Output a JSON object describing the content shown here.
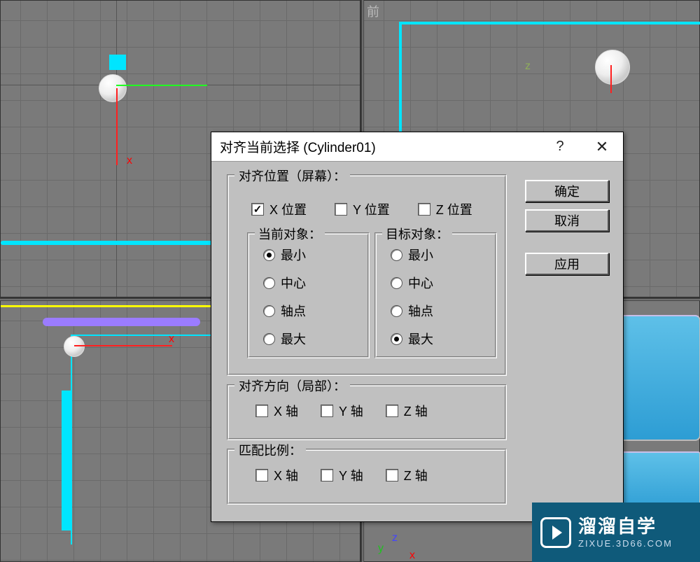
{
  "viewports": {
    "top_right_label": "前"
  },
  "dialog": {
    "title": "对齐当前选择 (Cylinder01)",
    "help_symbol": "?",
    "close_symbol": "✕",
    "buttons": {
      "ok": "确定",
      "cancel": "取消",
      "apply": "应用"
    },
    "align_position": {
      "title": "对齐位置（屏幕）：",
      "x": {
        "label": "X 位置",
        "checked": true
      },
      "y": {
        "label": "Y 位置",
        "checked": false
      },
      "z": {
        "label": "Z 位置",
        "checked": false
      },
      "current": {
        "title": "当前对象：",
        "options": [
          "最小",
          "中心",
          "轴点",
          "最大"
        ],
        "selected": "最小"
      },
      "target": {
        "title": "目标对象：",
        "options": [
          "最小",
          "中心",
          "轴点",
          "最大"
        ],
        "selected": "最大"
      }
    },
    "align_orientation": {
      "title": "对齐方向（局部）：",
      "x": {
        "label": "X 轴",
        "checked": false
      },
      "y": {
        "label": "Y 轴",
        "checked": false
      },
      "z": {
        "label": "Z 轴",
        "checked": false
      }
    },
    "match_scale": {
      "title": "匹配比例：",
      "x": {
        "label": "X 轴",
        "checked": false
      },
      "y": {
        "label": "Y 轴",
        "checked": false
      },
      "z": {
        "label": "Z 轴",
        "checked": false
      }
    }
  },
  "watermark": {
    "main": "溜溜自学",
    "sub": "ZIXUE.3D66.COM"
  }
}
